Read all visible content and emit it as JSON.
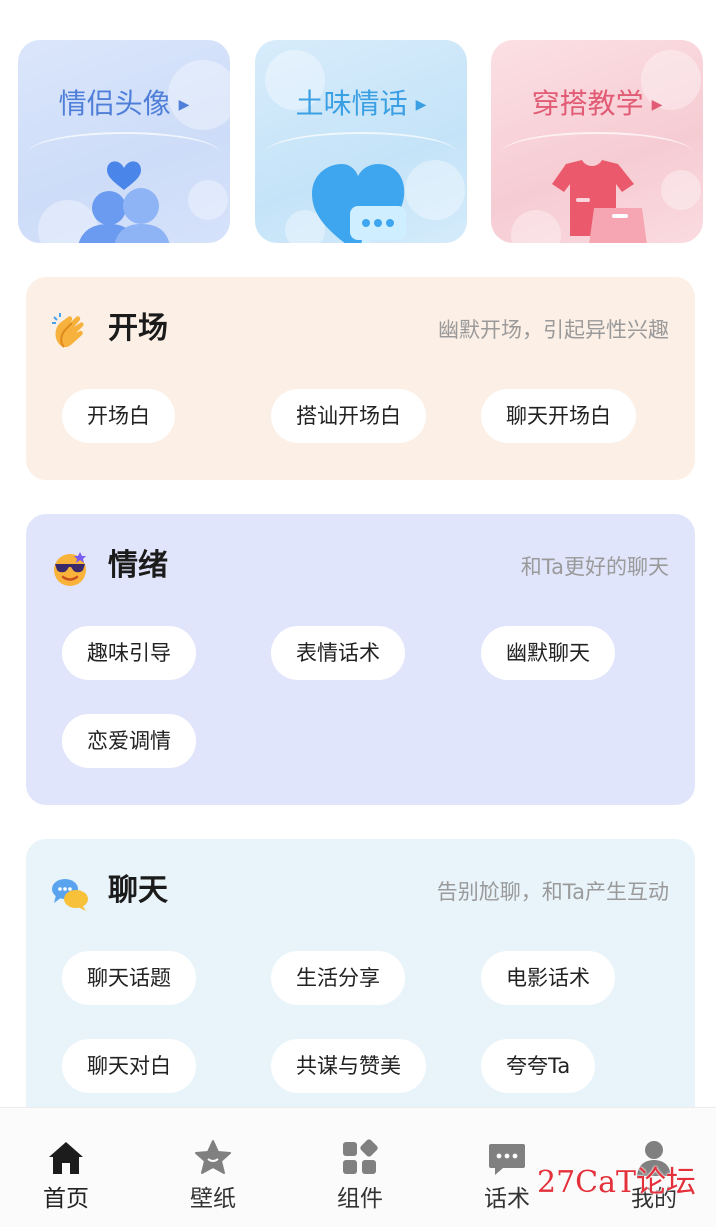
{
  "features": [
    {
      "title": "情侣头像",
      "icon": "couple-avatar-icon"
    },
    {
      "title": "土味情话",
      "icon": "heart-chat-icon"
    },
    {
      "title": "穿搭教学",
      "icon": "clothes-icon"
    }
  ],
  "sections": [
    {
      "title": "开场",
      "subtitle": "幽默开场，引起异性兴趣",
      "icon": "clapping-hands-icon",
      "chips": [
        "开场白",
        "搭讪开场白",
        "聊天开场白"
      ]
    },
    {
      "title": "情绪",
      "subtitle": "和Ta更好的聊天",
      "icon": "cool-face-icon",
      "chips": [
        "趣味引导",
        "表情话术",
        "幽默聊天",
        "恋爱调情"
      ]
    },
    {
      "title": "聊天",
      "subtitle": "告别尬聊，和Ta产生互动",
      "icon": "chat-bubbles-icon",
      "chips": [
        "聊天话题",
        "生活分享",
        "电影话术",
        "聊天对白",
        "共谋与赞美",
        "夸夸Ta"
      ]
    }
  ],
  "nav": [
    {
      "label": "首页",
      "icon": "home-icon",
      "active": true
    },
    {
      "label": "壁纸",
      "icon": "star-icon",
      "active": false
    },
    {
      "label": "组件",
      "icon": "widgets-icon",
      "active": false
    },
    {
      "label": "话术",
      "icon": "message-icon",
      "active": false
    },
    {
      "label": "我的",
      "icon": "user-icon",
      "active": false
    }
  ],
  "watermark": "27CaT论坛",
  "colors": {
    "feature1_title": "#4f7fd9",
    "feature2_title": "#3aa0e3",
    "feature3_title": "#e25b74",
    "panel1_bg": "#fcefe6",
    "panel2_bg": "#e1e5fb",
    "panel3_bg": "#e8f4fa",
    "watermark": "#e4303a"
  }
}
